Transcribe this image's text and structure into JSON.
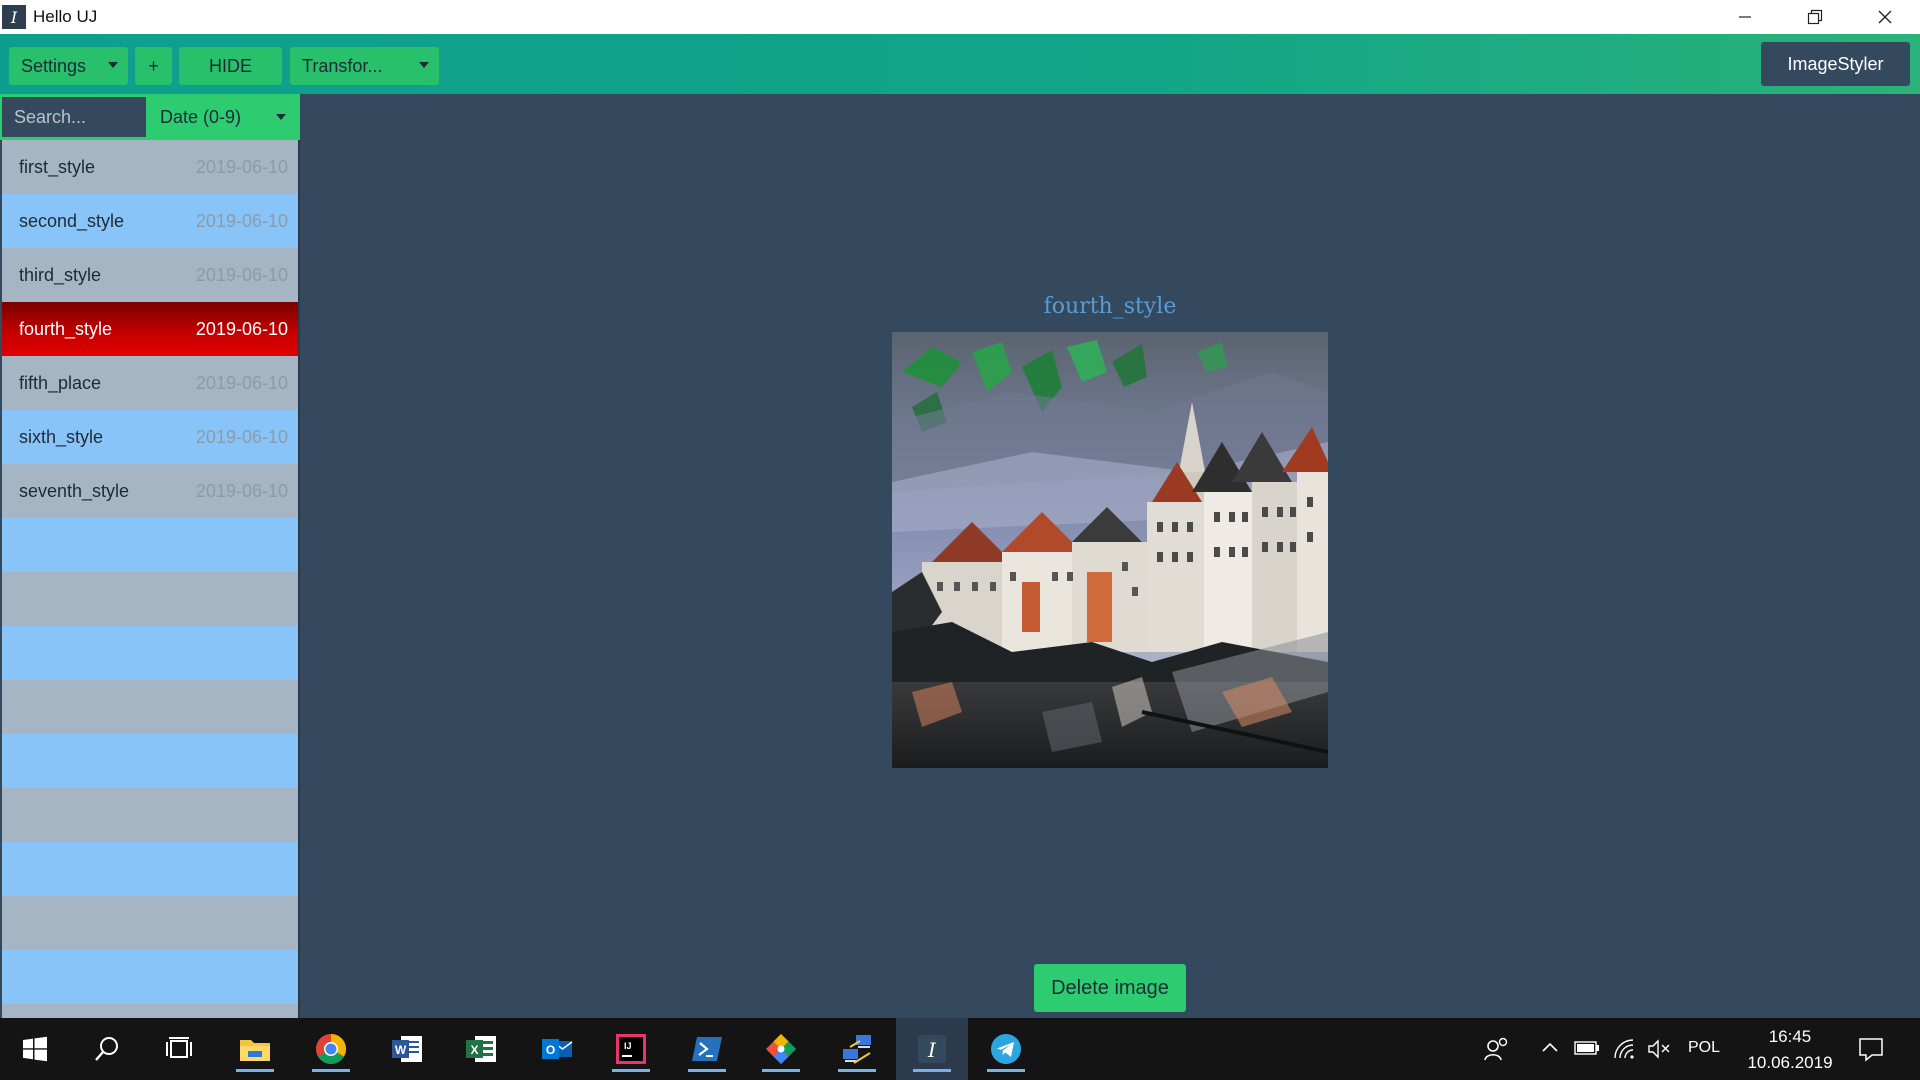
{
  "window": {
    "title": "Hello UJ",
    "icon_letter": "I",
    "controls": [
      "minimize-icon",
      "restore-icon",
      "close-icon"
    ]
  },
  "toolbar": {
    "settings_label": "Settings",
    "add_label": "+",
    "hide_label": "HIDE",
    "transform_label": "Transfor...",
    "brand_label": "ImageStyler"
  },
  "sidebar": {
    "search_placeholder": "Search...",
    "sort_label": "Date (0-9)",
    "items": [
      {
        "name": "first_style",
        "date": "2019-06-10"
      },
      {
        "name": "second_style",
        "date": "2019-06-10"
      },
      {
        "name": "third_style",
        "date": "2019-06-10"
      },
      {
        "name": "fourth_style",
        "date": "2019-06-10"
      },
      {
        "name": "fifth_place",
        "date": "2019-06-10"
      },
      {
        "name": "sixth_style",
        "date": "2019-06-10"
      },
      {
        "name": "seventh_style",
        "date": "2019-06-10"
      }
    ],
    "selected_index": 3
  },
  "main": {
    "image_title": "fourth_style",
    "delete_label": "Delete image"
  },
  "taskbar": {
    "apps": [
      "start-icon",
      "search-icon",
      "task-view-icon",
      "file-explorer-icon",
      "chrome-icon",
      "word-icon",
      "excel-icon",
      "outlook-icon",
      "intellij-icon",
      "powershell-icon",
      "git-icon",
      "network-icon",
      "image-styler-icon",
      "telegram-icon"
    ],
    "tray": {
      "language": "POL",
      "time": "16:45",
      "date": "10.06.2019"
    }
  },
  "colors": {
    "background": "#34495e",
    "accent_green": "#2ecc71",
    "row_gray": "#a6b5c3",
    "row_blue": "#89c4f8",
    "selected_red": "#c80000",
    "title_blue": "#5b9bd5"
  }
}
